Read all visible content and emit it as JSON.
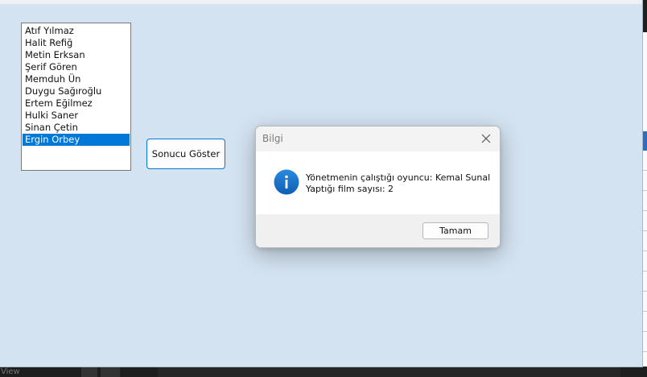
{
  "background_app": {
    "status_label": "View"
  },
  "form": {
    "listbox": {
      "items": [
        "Atıf Yılmaz",
        "Halit Refiğ",
        "Metin Erksan",
        "Şerif Gören",
        "Memduh Ün",
        "Duygu Sağıroğlu",
        "Ertem Eğilmez",
        "Hulki Saner",
        "Sinan Çetin",
        "Ergin Orbey"
      ],
      "selected_index": 9
    },
    "show_button_label": "Sonucu Göster"
  },
  "dialog": {
    "title": "Bilgi",
    "icon": "info-icon",
    "message_line1": "Yönetmenin çalıştığı oyuncu: Kemal Sunal",
    "message_line2": "Yaptığı film sayısı: 2",
    "ok_label": "Tamam"
  },
  "colors": {
    "accent": "#0078d7",
    "form_background": "#d4e3f2",
    "info_icon": "#1a73c9"
  }
}
